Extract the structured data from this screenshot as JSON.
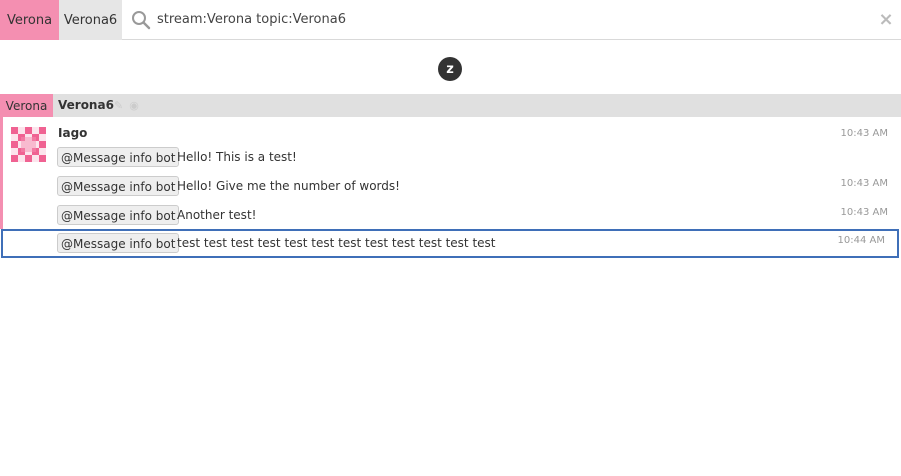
{
  "narrow": {
    "stream": "Verona",
    "topic": "Verona6",
    "query": "stream:Verona topic:Verona6",
    "close_icon": "×"
  },
  "logo": {
    "letter": "z"
  },
  "recipient_header": {
    "stream": "Verona",
    "topic": "Verona6"
  },
  "sender": {
    "name": "Iago",
    "time": "10:43 AM"
  },
  "messages": [
    {
      "mention": "@Message info bot",
      "text": "Hello! This is a test!",
      "time": ""
    },
    {
      "mention": "@Message info bot",
      "text": "Hello! Give me the number of words!",
      "time": "10:43 AM"
    },
    {
      "mention": "@Message info bot",
      "text": "Another test!",
      "time": "10:43 AM"
    },
    {
      "mention": "@Message info bot",
      "text": "test test test test test test test test test test test test",
      "time": "10:44 AM"
    }
  ],
  "colors": {
    "stream": "#f48fb1",
    "selected_border": "#3f6fb8"
  }
}
